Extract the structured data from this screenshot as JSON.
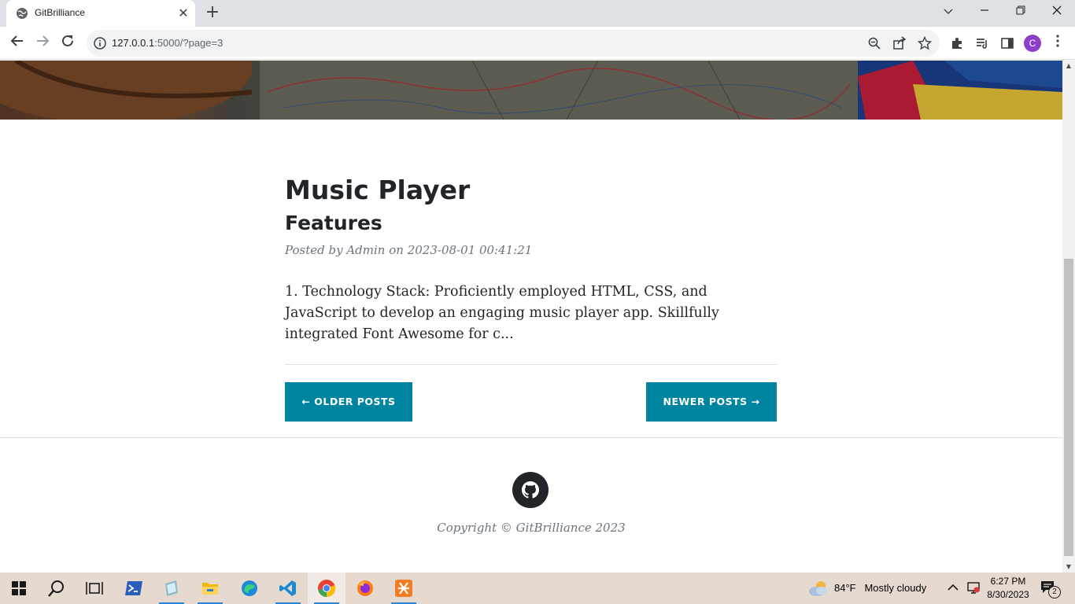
{
  "browser": {
    "tab_title": "GitBrilliance",
    "url_host": "127.0.0.1",
    "url_rest": ":5000/?page=3",
    "profile_initial": "C"
  },
  "post": {
    "title": "Music Player",
    "subtitle": "Features",
    "meta_prefix": "Posted by ",
    "author": "Admin",
    "meta_on": " on 2023-08-01 00:41:21",
    "excerpt": "1. Technology Stack: Proficiently employed HTML, CSS, and JavaScript to develop an engaging music player app. Skillfully integrated Font Awesome for c..."
  },
  "pager": {
    "older_label": "← OLDER POSTS",
    "newer_label": "NEWER POSTS →"
  },
  "footer": {
    "copyright": "Copyright © GitBrilliance 2023"
  },
  "taskbar": {
    "temperature": "84°F",
    "weather": "Mostly cloudy",
    "time": "6:27 PM",
    "date": "8/30/2023",
    "notification_count": "2"
  },
  "colors": {
    "accent": "#0085a1",
    "text": "#212529",
    "muted": "#6c757d"
  }
}
